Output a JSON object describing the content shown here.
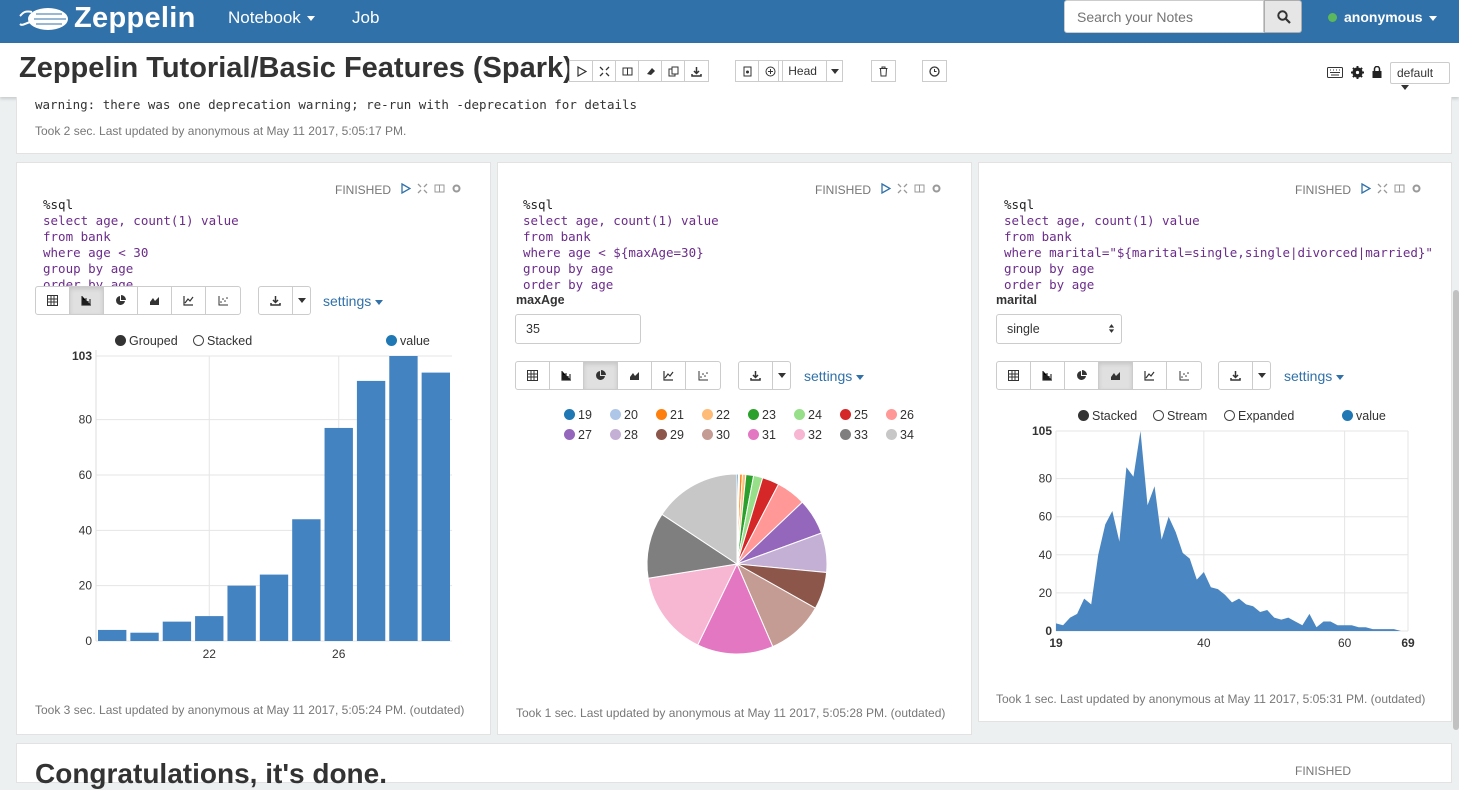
{
  "nav": {
    "brand": "Zeppelin",
    "notebook": "Notebook",
    "job": "Job",
    "search_placeholder": "Search your Notes",
    "user": "anonymous"
  },
  "header": {
    "title": "Zeppelin Tutorial/Basic Features (Spark)",
    "head_label": "Head",
    "default_label": "default"
  },
  "prev_paragraph": {
    "warning": "warning: there was one deprecation warning; re-run with -deprecation for details",
    "took": "Took 2 sec. Last updated by anonymous at May 11 2017, 5:05:17 PM."
  },
  "paragraphs": [
    {
      "status": "FINISHED",
      "code": [
        "%sql",
        "select age, count(1) value",
        "from bank",
        "where age < 30",
        "group by age",
        "order by age"
      ],
      "settings": "settings",
      "took": "Took 3 sec. Last updated by anonymous at May 11 2017, 5:05:24 PM. (outdated)",
      "legend": {
        "grouped": "Grouped",
        "stacked": "Stacked",
        "value": "value"
      }
    },
    {
      "status": "FINISHED",
      "code": [
        "%sql",
        "select age, count(1) value",
        "from bank",
        "where age < ${maxAge=30}",
        "group by age",
        "order by age"
      ],
      "param_label": "maxAge",
      "param_value": "35",
      "settings": "settings",
      "took": "Took 1 sec. Last updated by anonymous at May 11 2017, 5:05:28 PM. (outdated)"
    },
    {
      "status": "FINISHED",
      "code": [
        "%sql",
        "select age, count(1) value",
        "from bank",
        "where marital=\"${marital=single,single|divorced|married}\"",
        "group by age",
        "order by age"
      ],
      "param_label": "marital",
      "param_value": "single",
      "settings": "settings",
      "took": "Took 1 sec. Last updated by anonymous at May 11 2017, 5:05:31 PM. (outdated)",
      "legend": {
        "stacked": "Stacked",
        "stream": "Stream",
        "expanded": "Expanded",
        "value": "value"
      }
    }
  ],
  "next_paragraph": {
    "title": "Congratulations, it's done.",
    "status": "FINISHED"
  },
  "colors": {
    "accent": "#3071a9",
    "bar": "#4483c2",
    "area": "#4a86c2"
  },
  "chart_data": [
    {
      "type": "bar",
      "x": [
        19,
        20,
        21,
        22,
        23,
        24,
        25,
        26,
        27,
        28,
        29
      ],
      "values": [
        4,
        3,
        7,
        9,
        20,
        24,
        44,
        77,
        94,
        103,
        97
      ],
      "xticks": [
        22,
        26
      ],
      "yticks": [
        0,
        20,
        40,
        60,
        80,
        103
      ],
      "ylim": [
        0,
        103
      ],
      "series": [
        {
          "name": "value"
        }
      ]
    },
    {
      "type": "pie",
      "categories": [
        "19",
        "20",
        "21",
        "22",
        "23",
        "24",
        "25",
        "26",
        "27",
        "28",
        "29",
        "30",
        "31",
        "32",
        "33",
        "34"
      ],
      "values": [
        4,
        3,
        7,
        9,
        20,
        24,
        44,
        77,
        94,
        103,
        97,
        150,
        199,
        222,
        172,
        228
      ],
      "colors": [
        "#1f77b4",
        "#aec7e8",
        "#ff7f0e",
        "#ffbb78",
        "#2ca02c",
        "#98df8a",
        "#d62728",
        "#ff9896",
        "#9467bd",
        "#c5b0d5",
        "#8c564b",
        "#c49c94",
        "#e377c2",
        "#f7b6d2",
        "#7f7f7f",
        "#c7c7c7"
      ]
    },
    {
      "type": "area",
      "x": [
        19,
        20,
        21,
        22,
        23,
        24,
        25,
        26,
        27,
        28,
        29,
        30,
        31,
        32,
        33,
        34,
        35,
        36,
        37,
        38,
        39,
        40,
        41,
        42,
        43,
        44,
        45,
        46,
        47,
        48,
        49,
        50,
        51,
        52,
        53,
        54,
        55,
        56,
        57,
        58,
        59,
        60,
        61,
        62,
        63,
        64,
        65,
        66,
        67,
        68,
        69
      ],
      "values": [
        4,
        3,
        7,
        9,
        17,
        14,
        40,
        56,
        63,
        47,
        86,
        81,
        105,
        66,
        76,
        48,
        60,
        52,
        41,
        38,
        27,
        31,
        23,
        22,
        19,
        15,
        17,
        14,
        13,
        10,
        11,
        7,
        6,
        7,
        5,
        3,
        9,
        2,
        5,
        5,
        3,
        3,
        3,
        2,
        2,
        1,
        1,
        1,
        1,
        0,
        0
      ],
      "xticks": [
        19,
        40,
        60,
        69
      ],
      "yticks": [
        0,
        20,
        40,
        60,
        80,
        105
      ],
      "ylim": [
        0,
        105
      ],
      "series": [
        {
          "name": "value"
        }
      ]
    }
  ]
}
